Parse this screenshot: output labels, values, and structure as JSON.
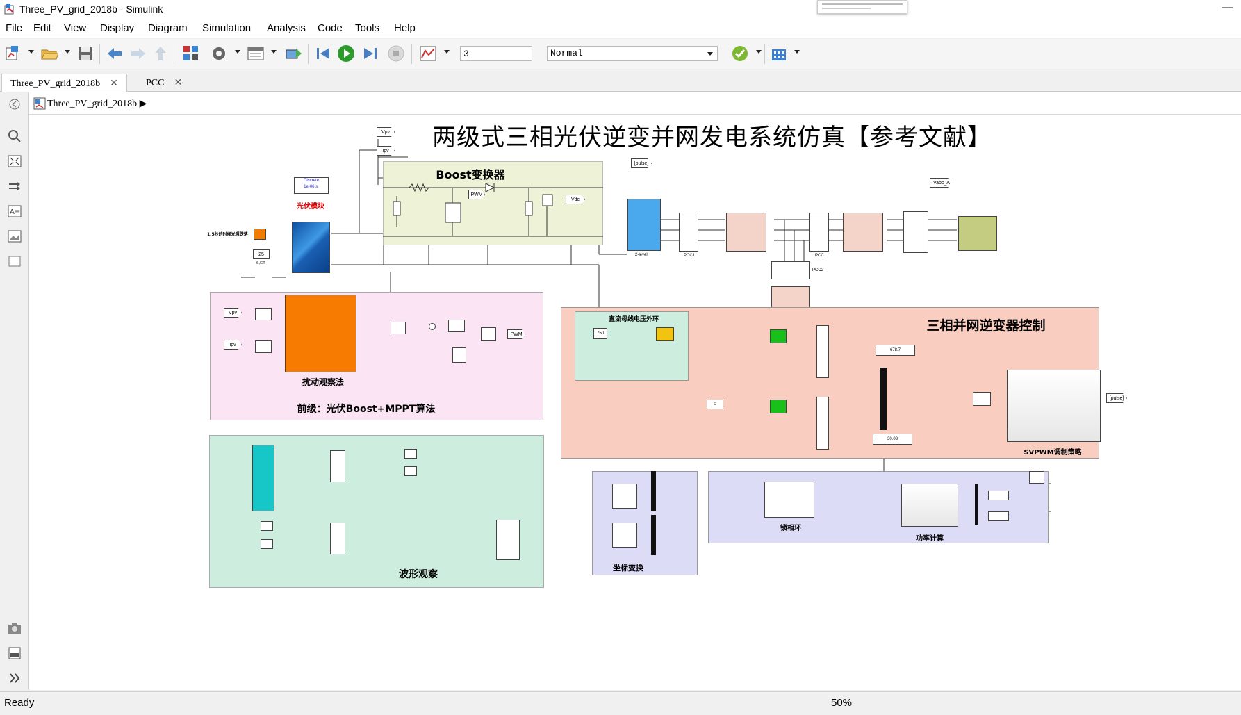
{
  "window": {
    "title": "Three_PV_grid_2018b - Simulink",
    "minimize": "—"
  },
  "menu": [
    "File",
    "Edit",
    "View",
    "Display",
    "Diagram",
    "Simulation",
    "Analysis",
    "Code",
    "Tools",
    "Help"
  ],
  "toolbar": {
    "stop_time": "3",
    "sim_mode": "Normal"
  },
  "tabs": [
    {
      "label": "Three_PV_grid_2018b",
      "close": "✕"
    },
    {
      "label": "PCC",
      "close": "✕"
    }
  ],
  "breadcrumb": {
    "model": "Three_PV_grid_2018b",
    "arrow": "▶"
  },
  "model": {
    "title": "两级式三相光伏逆变并网发电系统仿真【参考文献】",
    "powergui": "Discrete\n1e-06 s.",
    "pv_label": "光伏模块",
    "step_label": "1.5秒的时候光照跌落",
    "temp_value": "25",
    "temp_label": "S,/ET",
    "boost_label": "Boost变换器",
    "pwm_tag": "PWM",
    "vdc_tag": "Vdc",
    "vpv_tag": "Vpv",
    "ipv_tag": "Ipv",
    "pulse_tag": "[pulse]",
    "vabc_tag": "Vabc_A",
    "inverter_label": "2-level",
    "pcc1_label": "PCC1",
    "pcc_label": "PCC",
    "pcc2_label": "PCC2",
    "mppt_block_label": "扰动观察法",
    "mppt_panel_label": "前级：光伏Boost+MPPT算法",
    "scope_panel_label": "波形观察",
    "ctrl_panel_label": "三相并网逆变器控制",
    "dc_loop_label": "直流母线电压外环",
    "dc_ref": "750",
    "svpwm_label": "SVPWM调制策略",
    "coord_label": "坐标变换",
    "pll_label": "锁相环",
    "power_label": "功率计算",
    "disp1": "678.7",
    "disp2": "30.03",
    "zero": "0"
  },
  "status": {
    "ready": "Ready",
    "zoom": "50%"
  }
}
